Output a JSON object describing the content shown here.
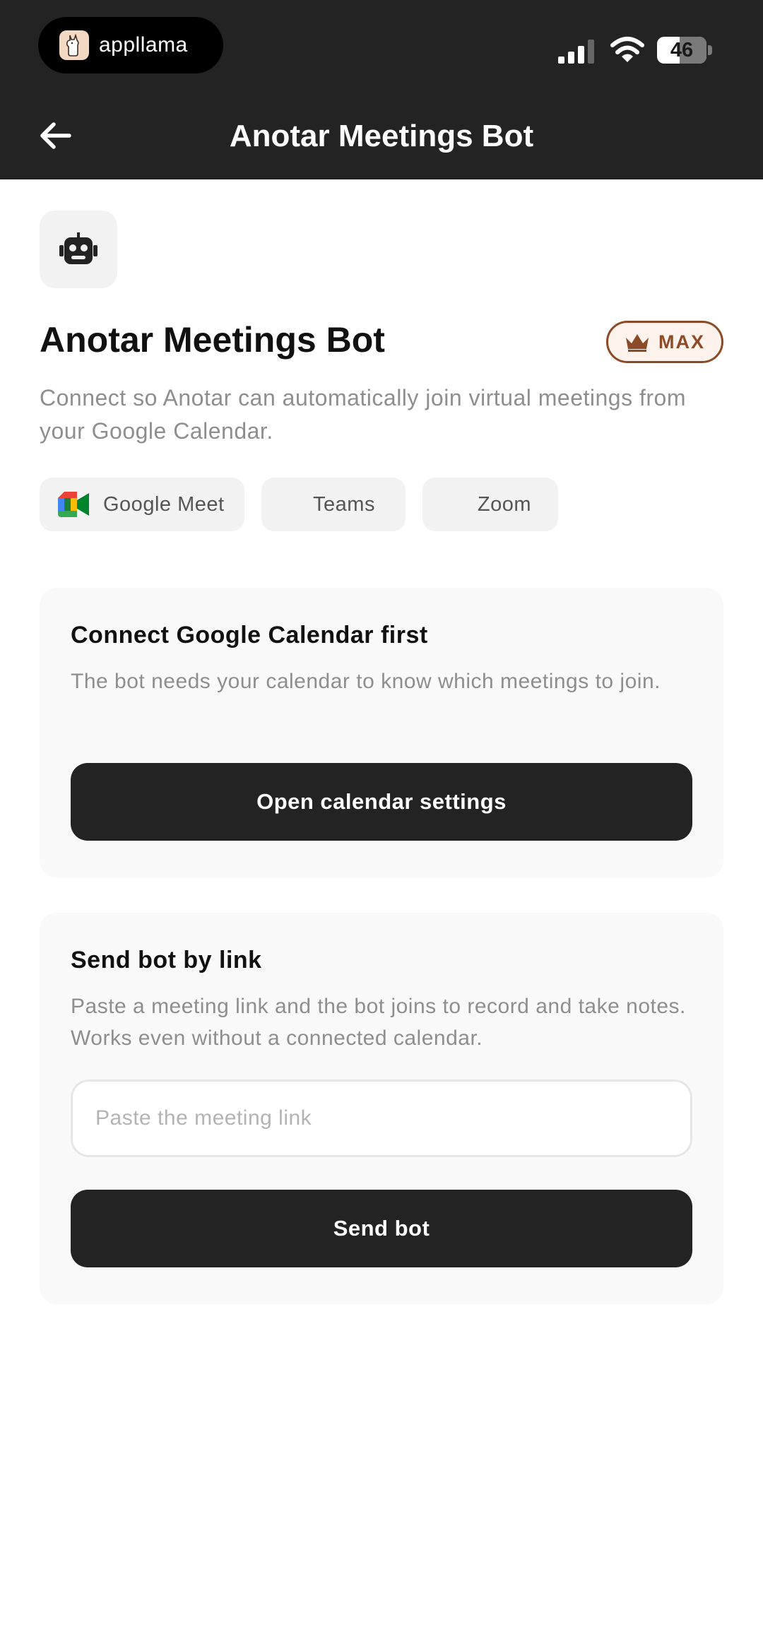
{
  "status_bar": {
    "brand": "appllama",
    "battery": "46"
  },
  "nav": {
    "title": "Anotar Meetings Bot",
    "back_icon": "arrow-left-icon"
  },
  "integration": {
    "icon": "robot-icon",
    "title": "Anotar Meetings Bot",
    "badge": "MAX",
    "badge_icon": "crown-icon",
    "description": "Connect so Anotar can automatically join virtual meetings from your Google Calendar.",
    "platforms": [
      "Google Meet",
      "Teams",
      "Zoom"
    ]
  },
  "calendar_card": {
    "title": "Connect Google Calendar first",
    "text": "The bot needs your calendar to know which meetings to join.",
    "button_label": "Open calendar settings"
  },
  "link_card": {
    "title": "Send bot by link",
    "text": "Paste a meeting link and the bot joins to record and take notes. Works even without a connected calendar.",
    "input_placeholder": "Paste the meeting link",
    "input_value": "",
    "button_label": "Send bot"
  },
  "colors": {
    "header_bg": "#232323",
    "card_bg": "#f9f9f9",
    "button_bg": "#232323",
    "badge_accent": "#8c4a26",
    "muted_text": "#8e8e8e"
  }
}
